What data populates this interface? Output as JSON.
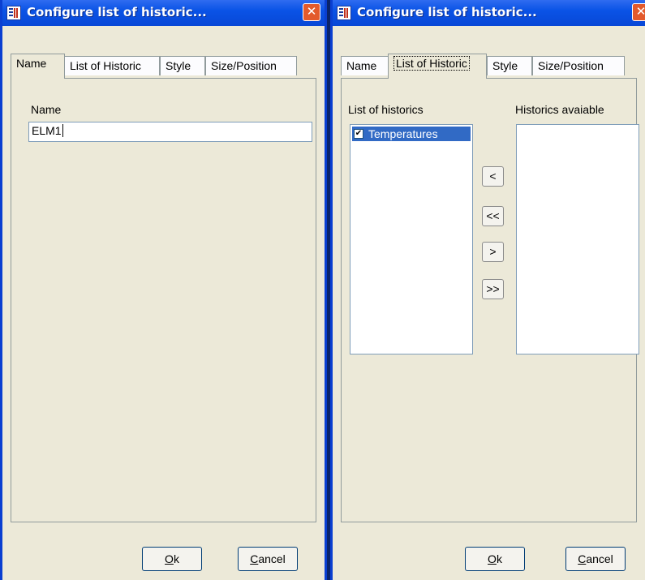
{
  "dialog_left": {
    "title": "Configure list of historic...",
    "tabs": [
      "Name",
      "List of Historic",
      "Style",
      "Size/Position"
    ],
    "name_label": "Name",
    "name_value": "ELM1",
    "ok": {
      "mnemonic": "O",
      "rest": "k"
    },
    "cancel": {
      "mnemonic": "C",
      "rest": "ancel"
    }
  },
  "dialog_right": {
    "title": "Configure list of historic...",
    "tabs": [
      "Name",
      "List of Historic",
      "Style",
      "Size/Position"
    ],
    "list_label": "List of historics",
    "available_label": "Historics avaiable",
    "historics": [
      {
        "label": "Temperatures",
        "checked": true
      }
    ],
    "move_buttons": [
      "<",
      "<<",
      ">",
      ">>"
    ],
    "ok": {
      "mnemonic": "O",
      "rest": "k"
    },
    "cancel": {
      "mnemonic": "C",
      "rest": "ancel"
    }
  },
  "icons": {
    "check": "✔",
    "close": "✕"
  }
}
